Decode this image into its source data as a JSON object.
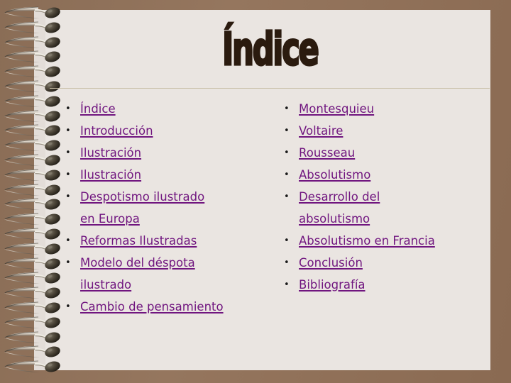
{
  "slide": {
    "title": "Índice",
    "template_name": "notebook-spiral-template",
    "colors": {
      "board": "#8E7059",
      "paper": "#EAE5E1",
      "title_text": "#2B1B0F",
      "link_text": "#70157F",
      "bullet": "#1A1A1A",
      "divider": "#C9BFA8"
    },
    "spiral": {
      "ring_count": 25,
      "icon": "spiral-binding-ring"
    }
  },
  "toc": {
    "left_column": [
      {
        "label": "Índice",
        "lines": [
          "Índice"
        ]
      },
      {
        "label": "Introducción",
        "lines": [
          "Introducción"
        ]
      },
      {
        "label": "Ilustración",
        "lines": [
          "Ilustración"
        ]
      },
      {
        "label": "Ilustración",
        "lines": [
          "Ilustración"
        ]
      },
      {
        "label": "Despotismo ilustrado en Europa",
        "lines": [
          "Despotismo ilustrado",
          "en Europa"
        ]
      },
      {
        "label": "Reformas Ilustradas",
        "lines": [
          "Reformas Ilustradas"
        ]
      },
      {
        "label": "Modelo del déspota ilustrado",
        "lines": [
          "Modelo del déspota",
          "ilustrado"
        ]
      },
      {
        "label": "Cambio de pensamiento",
        "lines": [
          "Cambio de pensamiento"
        ]
      }
    ],
    "right_column": [
      {
        "label": "Montesquieu",
        "lines": [
          "Montesquieu"
        ]
      },
      {
        "label": "Voltaire",
        "lines": [
          "Voltaire"
        ]
      },
      {
        "label": "Rousseau",
        "lines": [
          "Rousseau"
        ]
      },
      {
        "label": "Absolutismo",
        "lines": [
          "Absolutismo"
        ]
      },
      {
        "label": "Desarrollo del absolutismo",
        "lines": [
          "Desarrollo del",
          "absolutismo"
        ]
      },
      {
        "label": "Absolutismo en Francia",
        "lines": [
          "Absolutismo en Francia"
        ]
      },
      {
        "label": "Conclusión",
        "lines": [
          "Conclusión"
        ]
      },
      {
        "label": "Bibliografía",
        "lines": [
          "Bibliografía"
        ]
      }
    ]
  }
}
